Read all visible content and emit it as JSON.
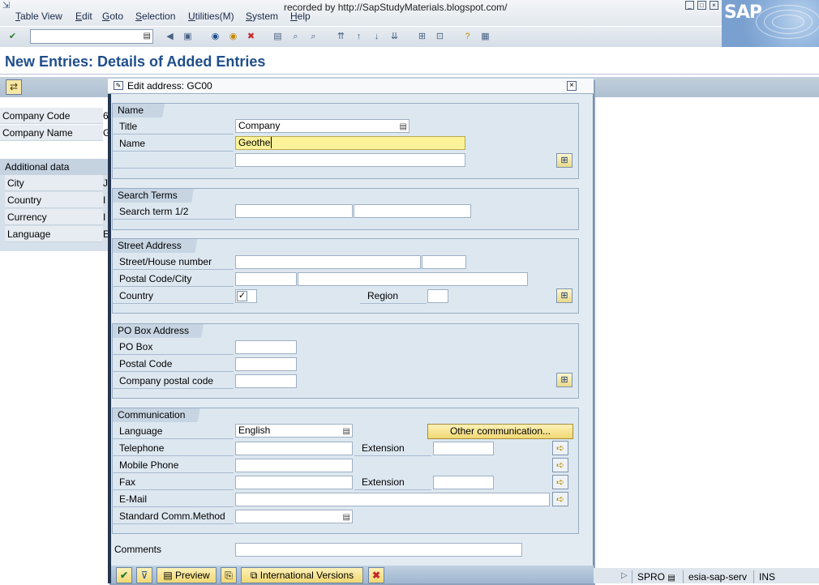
{
  "menubar": {
    "items": [
      "Table View",
      "Edit",
      "Goto",
      "Selection",
      "Utilities(M)",
      "System",
      "Help"
    ],
    "recorded_by": "recorded by http://SapStudyMaterials.blogspot.com/"
  },
  "logo": {
    "text": "SAP"
  },
  "page": {
    "title": "New Entries: Details of Added Entries"
  },
  "background_form": {
    "company_code_label": "Company Code",
    "company_code_value": "6",
    "company_name_label": "Company Name",
    "company_name_value": "G",
    "additional_data_title": "Additional data",
    "additional_fields": [
      {
        "label": "City",
        "value": "J"
      },
      {
        "label": "Country",
        "value": "I"
      },
      {
        "label": "Currency",
        "value": "I"
      },
      {
        "label": "Language",
        "value": "E"
      }
    ]
  },
  "popup": {
    "title": "Edit address:  GC00",
    "name_group": {
      "title": "Name",
      "title_label": "Title",
      "title_value": "Company",
      "name_label": "Name",
      "name_value": "Geothe"
    },
    "search_group": {
      "title": "Search Terms",
      "search_label": "Search term 1/2"
    },
    "street_group": {
      "title": "Street Address",
      "street_label": "Street/House number",
      "postal_label": "Postal Code/City",
      "country_label": "Country",
      "region_label": "Region",
      "country_check": "✓"
    },
    "pobox_group": {
      "title": "PO Box Address",
      "pobox_label": "PO Box",
      "postal_label": "Postal Code",
      "company_postal_label": "Company postal code"
    },
    "comm_group": {
      "title": "Communication",
      "language_label": "Language",
      "language_value": "English",
      "telephone_label": "Telephone",
      "extension_label": "Extension",
      "mobile_label": "Mobile Phone",
      "fax_label": "Fax",
      "fax_extension_label": "Extension",
      "email_label": "E-Mail",
      "std_comm_label": "Standard Comm.Method",
      "other_comm_button": "Other communication..."
    },
    "comments_label": "Comments",
    "bottom_buttons": {
      "preview": "Preview",
      "international": "International Versions"
    }
  },
  "statusbar": {
    "transaction": "SPRO",
    "server": "esia-sap-serv",
    "mode": "INS"
  },
  "colors": {
    "title_blue": "#1f4e8c",
    "active_field": "#fbf29a",
    "button_yellow": "#f0d873"
  }
}
